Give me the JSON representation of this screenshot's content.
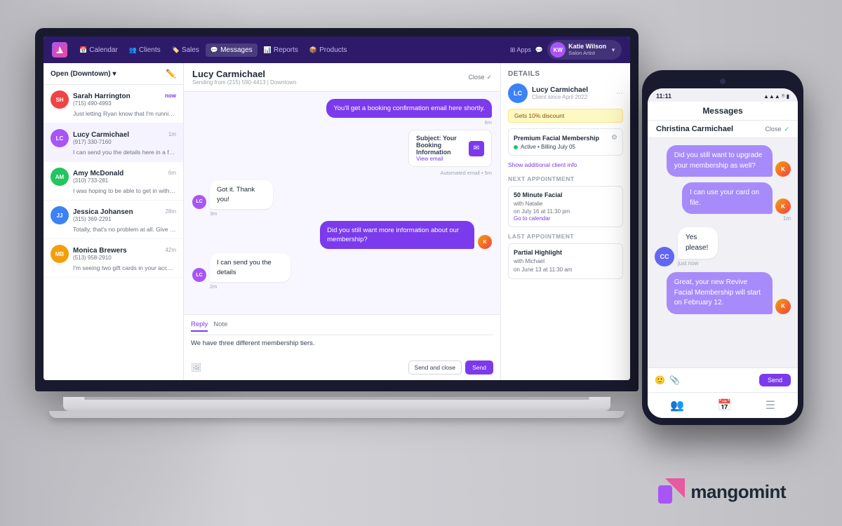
{
  "background": {
    "color": "#c5c5ca"
  },
  "navbar": {
    "logo_text": "M",
    "items": [
      {
        "label": "Calendar",
        "icon": "📅",
        "active": false
      },
      {
        "label": "Clients",
        "icon": "👥",
        "active": false
      },
      {
        "label": "Sales",
        "icon": "🏷️",
        "active": false
      },
      {
        "label": "Messages",
        "icon": "💬",
        "active": true
      },
      {
        "label": "Reports",
        "icon": "📊",
        "active": false
      },
      {
        "label": "Products",
        "icon": "📦",
        "active": false
      }
    ],
    "apps_label": "Apps",
    "user": {
      "name": "Katie Wilson",
      "role": "Salon Artist",
      "initials": "KW"
    }
  },
  "conversations_panel": {
    "title": "Open (Downtown)",
    "items": [
      {
        "initials": "SH",
        "color": "#ef4444",
        "name": "Sarah Harrington",
        "phone": "(715) 490-4993",
        "time": "now",
        "time_new": true,
        "preview": "Just letting Ryan know that I'm running a little late..."
      },
      {
        "initials": "LC",
        "color": "#a855f7",
        "name": "Lucy Carmichael",
        "phone": "(917) 330-7160",
        "time": "1m",
        "time_new": false,
        "preview": "I can send you the details here in a few...",
        "active": true
      },
      {
        "initials": "AM",
        "color": "#22c55e",
        "name": "Amy McDonald",
        "phone": "(310) 733-281",
        "time": "6m",
        "time_new": false,
        "preview": "I was hoping to be able to get in with Michael befor..."
      },
      {
        "initials": "JJ",
        "color": "#3b82f6",
        "name": "Jessica Johansen",
        "phone": "(315) 369-2291",
        "time": "28m",
        "time_new": false,
        "preview": "Totally, that's no problem at all. Give me one s..."
      },
      {
        "initials": "MB",
        "color": "#f59e0b",
        "name": "Monica Brewers",
        "phone": "(513) 958-2910",
        "time": "42m",
        "time_new": false,
        "preview": "I'm seeing two gift cards in your account. One..."
      }
    ]
  },
  "message_thread": {
    "contact_name": "Lucy Carmichael",
    "sending_from": "Sending from (215) 590-4413 | Downtown",
    "close_label": "Close",
    "messages": [
      {
        "type": "outgoing",
        "text": "You'll get a booking confirmation email here shortly.",
        "time": "6m"
      },
      {
        "type": "email_notification",
        "subject": "Subject: Your Booking Information",
        "link_text": "View email",
        "note": "Automated email • 5m"
      },
      {
        "type": "incoming",
        "text": "Got it. Thank you!",
        "time": "3m",
        "initials": "LC"
      },
      {
        "type": "outgoing",
        "text": "Did you still want more information about our membership?",
        "time": ""
      },
      {
        "type": "incoming",
        "text": "I can send you the details",
        "time": "2m",
        "initials": "LC"
      }
    ],
    "reply_tabs": [
      "Reply",
      "Note"
    ],
    "reply_text": "We have three different membership tiers.",
    "send_close_label": "Send and close",
    "send_label": "Send"
  },
  "details_panel": {
    "title": "Details",
    "client": {
      "initials": "LC",
      "color": "#3b82f6",
      "name": "Lucy Carmichael",
      "since": "Client since April 2022"
    },
    "discount": "Gets 10% discount",
    "membership": {
      "name": "Premium Facial Membership",
      "status": "Active",
      "billing": "Billing July 05"
    },
    "show_more": "Show additional client info",
    "next_appointment": {
      "label": "Next appointment",
      "service": "50 Minute Facial",
      "with": "with Natalie",
      "date": "on July 16 at 11:30 pm",
      "link": "Go to calendar"
    },
    "last_appointment": {
      "label": "Last appointment",
      "service": "Partial Highlight",
      "with": "with Michael",
      "date": "on June 13 at 11:30 am"
    }
  },
  "phone": {
    "status_bar": {
      "time": "11:11",
      "signal": "▲ ▲ ▲",
      "wifi": "wifi",
      "battery": "battery"
    },
    "app_title": "Messages",
    "chat": {
      "contact_name": "Christina Carmichael",
      "close_label": "Close",
      "messages": [
        {
          "type": "outgoing",
          "text": "Did you still want to upgrade your membership as well?"
        },
        {
          "type": "outgoing",
          "text": "I can use your card on file.",
          "time": "1m"
        },
        {
          "type": "incoming",
          "text": "Yes please!",
          "initials": "CC",
          "time": "just now"
        },
        {
          "type": "outgoing_system",
          "text": "Great, your new Revive Facial Membership will start on February 12."
        }
      ],
      "reply_text": "",
      "send_label": "Send"
    },
    "bottom_nav": [
      {
        "icon": "👥",
        "label": "clients"
      },
      {
        "icon": "📅",
        "label": "calendar"
      },
      {
        "icon": "☰",
        "label": "menu"
      }
    ]
  },
  "brand": {
    "name": "mangomint"
  }
}
